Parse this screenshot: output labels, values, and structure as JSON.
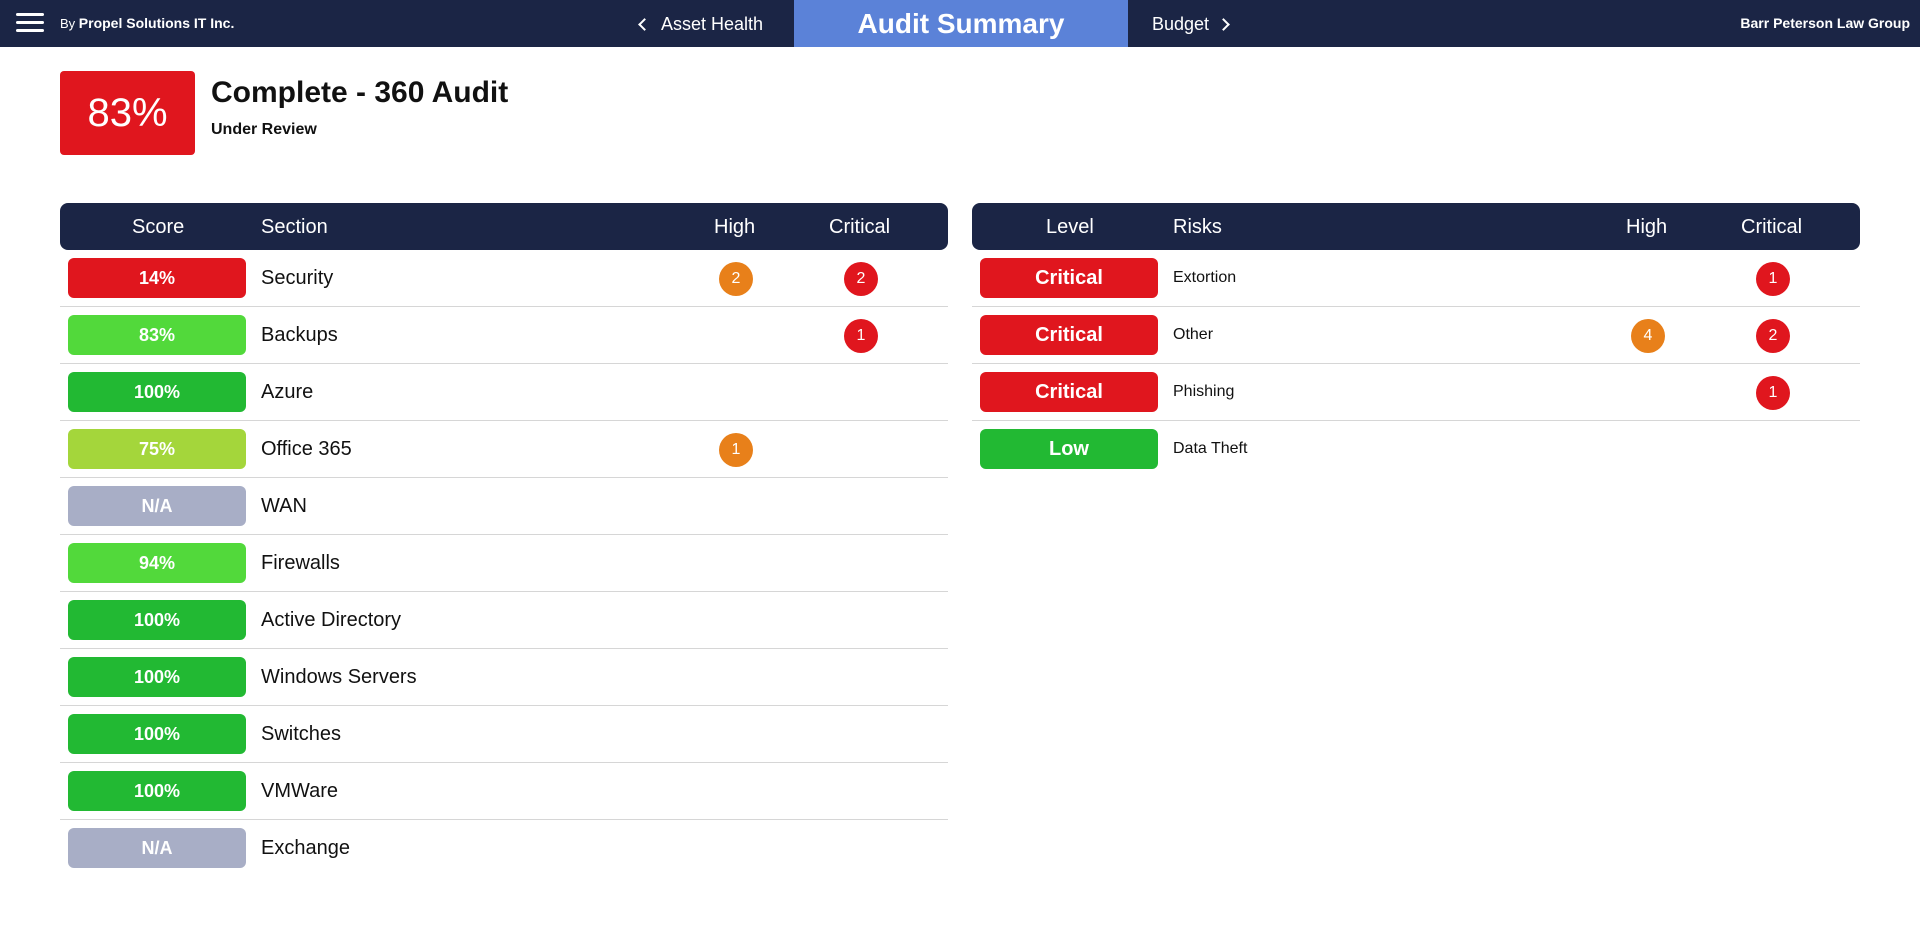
{
  "header": {
    "by_prefix": "By",
    "company": "Propel Solutions IT Inc.",
    "prev_label": "Asset Health",
    "active_tab": "Audit Summary",
    "next_label": "Budget",
    "client": "Barr Peterson Law Group",
    "bg_color": "#1b2545",
    "active_color": "#5b82d8"
  },
  "summary": {
    "score": "83%",
    "score_color": "#e0161e",
    "title": "Complete - 360 Audit",
    "status": "Under Review"
  },
  "sections_table": {
    "headers": {
      "score": "Score",
      "section": "Section",
      "high": "High",
      "critical": "Critical"
    },
    "rows": [
      {
        "score": "14%",
        "color": "#e0161e",
        "section": "Security",
        "high": "2",
        "critical": "2"
      },
      {
        "score": "83%",
        "color": "#52d93b",
        "section": "Backups",
        "high": "",
        "critical": "1"
      },
      {
        "score": "100%",
        "color": "#22b933",
        "section": "Azure",
        "high": "",
        "critical": ""
      },
      {
        "score": "75%",
        "color": "#a4d63b",
        "section": "Office 365",
        "high": "1",
        "critical": ""
      },
      {
        "score": "N/A",
        "color": "#a8aec6",
        "section": "WAN",
        "high": "",
        "critical": ""
      },
      {
        "score": "94%",
        "color": "#52d93b",
        "section": "Firewalls",
        "high": "",
        "critical": ""
      },
      {
        "score": "100%",
        "color": "#22b933",
        "section": "Active Directory",
        "high": "",
        "critical": ""
      },
      {
        "score": "100%",
        "color": "#22b933",
        "section": "Windows Servers",
        "high": "",
        "critical": ""
      },
      {
        "score": "100%",
        "color": "#22b933",
        "section": "Switches",
        "high": "",
        "critical": ""
      },
      {
        "score": "100%",
        "color": "#22b933",
        "section": "VMWare",
        "high": "",
        "critical": ""
      },
      {
        "score": "N/A",
        "color": "#a8aec6",
        "section": "Exchange",
        "high": "",
        "critical": ""
      }
    ]
  },
  "risks_table": {
    "headers": {
      "level": "Level",
      "risks": "Risks",
      "high": "High",
      "critical": "Critical"
    },
    "rows": [
      {
        "level": "Critical",
        "color": "#e0161e",
        "risk": "Extortion",
        "high": "",
        "critical": "1"
      },
      {
        "level": "Critical",
        "color": "#e0161e",
        "risk": "Other",
        "high": "4",
        "critical": "2"
      },
      {
        "level": "Critical",
        "color": "#e0161e",
        "risk": "Phishing",
        "high": "",
        "critical": "1"
      },
      {
        "level": "Low",
        "color": "#22b933",
        "risk": "Data Theft",
        "high": "",
        "critical": ""
      }
    ]
  },
  "badge_colors": {
    "high": "#e8801a",
    "critical": "#e0161e"
  }
}
